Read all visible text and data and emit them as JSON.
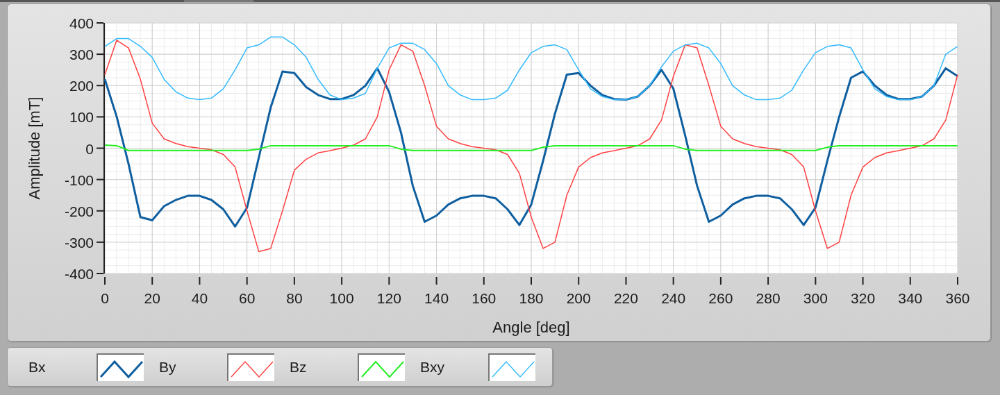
{
  "graph": {
    "chart_data": {
      "type": "line",
      "grid": true,
      "xlabel": "Angle [deg]",
      "ylabel": "Amplitude [mT]",
      "x": [
        0,
        5,
        10,
        15,
        20,
        25,
        30,
        35,
        40,
        45,
        50,
        55,
        60,
        65,
        70,
        75,
        80,
        85,
        90,
        95,
        100,
        105,
        110,
        115,
        120,
        125,
        130,
        135,
        140,
        145,
        150,
        155,
        160,
        165,
        170,
        175,
        180,
        185,
        190,
        195,
        200,
        205,
        210,
        215,
        220,
        225,
        230,
        235,
        240,
        245,
        250,
        255,
        260,
        265,
        270,
        275,
        280,
        285,
        290,
        295,
        300,
        305,
        310,
        315,
        320,
        325,
        330,
        335,
        340,
        345,
        350,
        355,
        360
      ],
      "xlim": [
        0,
        360
      ],
      "ylim": [
        -400,
        400
      ],
      "xticks": [
        0,
        20,
        40,
        60,
        80,
        100,
        120,
        140,
        160,
        180,
        200,
        220,
        240,
        260,
        280,
        300,
        320,
        340,
        360
      ],
      "yticks": [
        -400,
        -300,
        -200,
        -100,
        0,
        100,
        200,
        300,
        400
      ],
      "series": [
        {
          "name": "Bx",
          "color": "#0f5fa0",
          "values": [
            220,
            100,
            -50,
            -220,
            -230,
            -185,
            -165,
            -152,
            -152,
            -165,
            -195,
            -250,
            -190,
            -30,
            130,
            245,
            240,
            195,
            170,
            157,
            157,
            170,
            200,
            255,
            180,
            50,
            -120,
            -235,
            -215,
            -180,
            -160,
            -152,
            -152,
            -160,
            -195,
            -245,
            -180,
            -40,
            110,
            235,
            240,
            200,
            170,
            157,
            155,
            165,
            200,
            250,
            190,
            40,
            -120,
            -235,
            -215,
            -180,
            -160,
            -152,
            -152,
            -160,
            -195,
            -245,
            -190,
            -40,
            100,
            225,
            245,
            200,
            170,
            157,
            157,
            165,
            200,
            255,
            230
          ]
        },
        {
          "name": "By",
          "color": "#ff4040",
          "values": [
            235,
            345,
            320,
            220,
            80,
            30,
            15,
            5,
            0,
            -5,
            -20,
            -60,
            -200,
            -330,
            -320,
            -200,
            -70,
            -35,
            -15,
            -8,
            0,
            10,
            30,
            100,
            250,
            330,
            310,
            200,
            70,
            30,
            15,
            5,
            0,
            -5,
            -20,
            -80,
            -220,
            -320,
            -300,
            -150,
            -60,
            -30,
            -15,
            -8,
            0,
            8,
            30,
            90,
            230,
            330,
            320,
            200,
            70,
            30,
            15,
            5,
            0,
            -5,
            -20,
            -60,
            -200,
            -320,
            -300,
            -150,
            -60,
            -30,
            -15,
            -8,
            0,
            8,
            30,
            90,
            235
          ]
        },
        {
          "name": "Bz",
          "color": "#22ee22",
          "values": [
            10,
            8,
            -7,
            -7,
            -7,
            -7,
            -7,
            -7,
            -7,
            -7,
            -7,
            -7,
            -7,
            -3,
            8,
            8,
            8,
            8,
            8,
            8,
            8,
            8,
            8,
            8,
            8,
            -3,
            -7,
            -7,
            -7,
            -7,
            -7,
            -7,
            -7,
            -7,
            -7,
            -7,
            -7,
            3,
            8,
            8,
            8,
            8,
            8,
            8,
            8,
            8,
            8,
            8,
            8,
            -3,
            -7,
            -7,
            -7,
            -7,
            -7,
            -7,
            -7,
            -7,
            -7,
            -7,
            -7,
            3,
            8,
            8,
            8,
            8,
            8,
            8,
            8,
            8,
            8,
            8,
            8
          ]
        },
        {
          "name": "Bxy",
          "color": "#33bbff",
          "values": [
            325,
            350,
            350,
            325,
            290,
            220,
            180,
            160,
            155,
            160,
            190,
            250,
            320,
            330,
            355,
            355,
            330,
            290,
            220,
            170,
            155,
            160,
            175,
            255,
            320,
            335,
            335,
            315,
            270,
            200,
            170,
            155,
            155,
            160,
            185,
            250,
            305,
            325,
            330,
            315,
            250,
            190,
            165,
            155,
            155,
            165,
            200,
            260,
            310,
            330,
            335,
            320,
            270,
            200,
            170,
            155,
            155,
            160,
            185,
            250,
            305,
            325,
            330,
            320,
            250,
            190,
            165,
            155,
            155,
            165,
            200,
            300,
            325
          ]
        }
      ]
    }
  }
}
